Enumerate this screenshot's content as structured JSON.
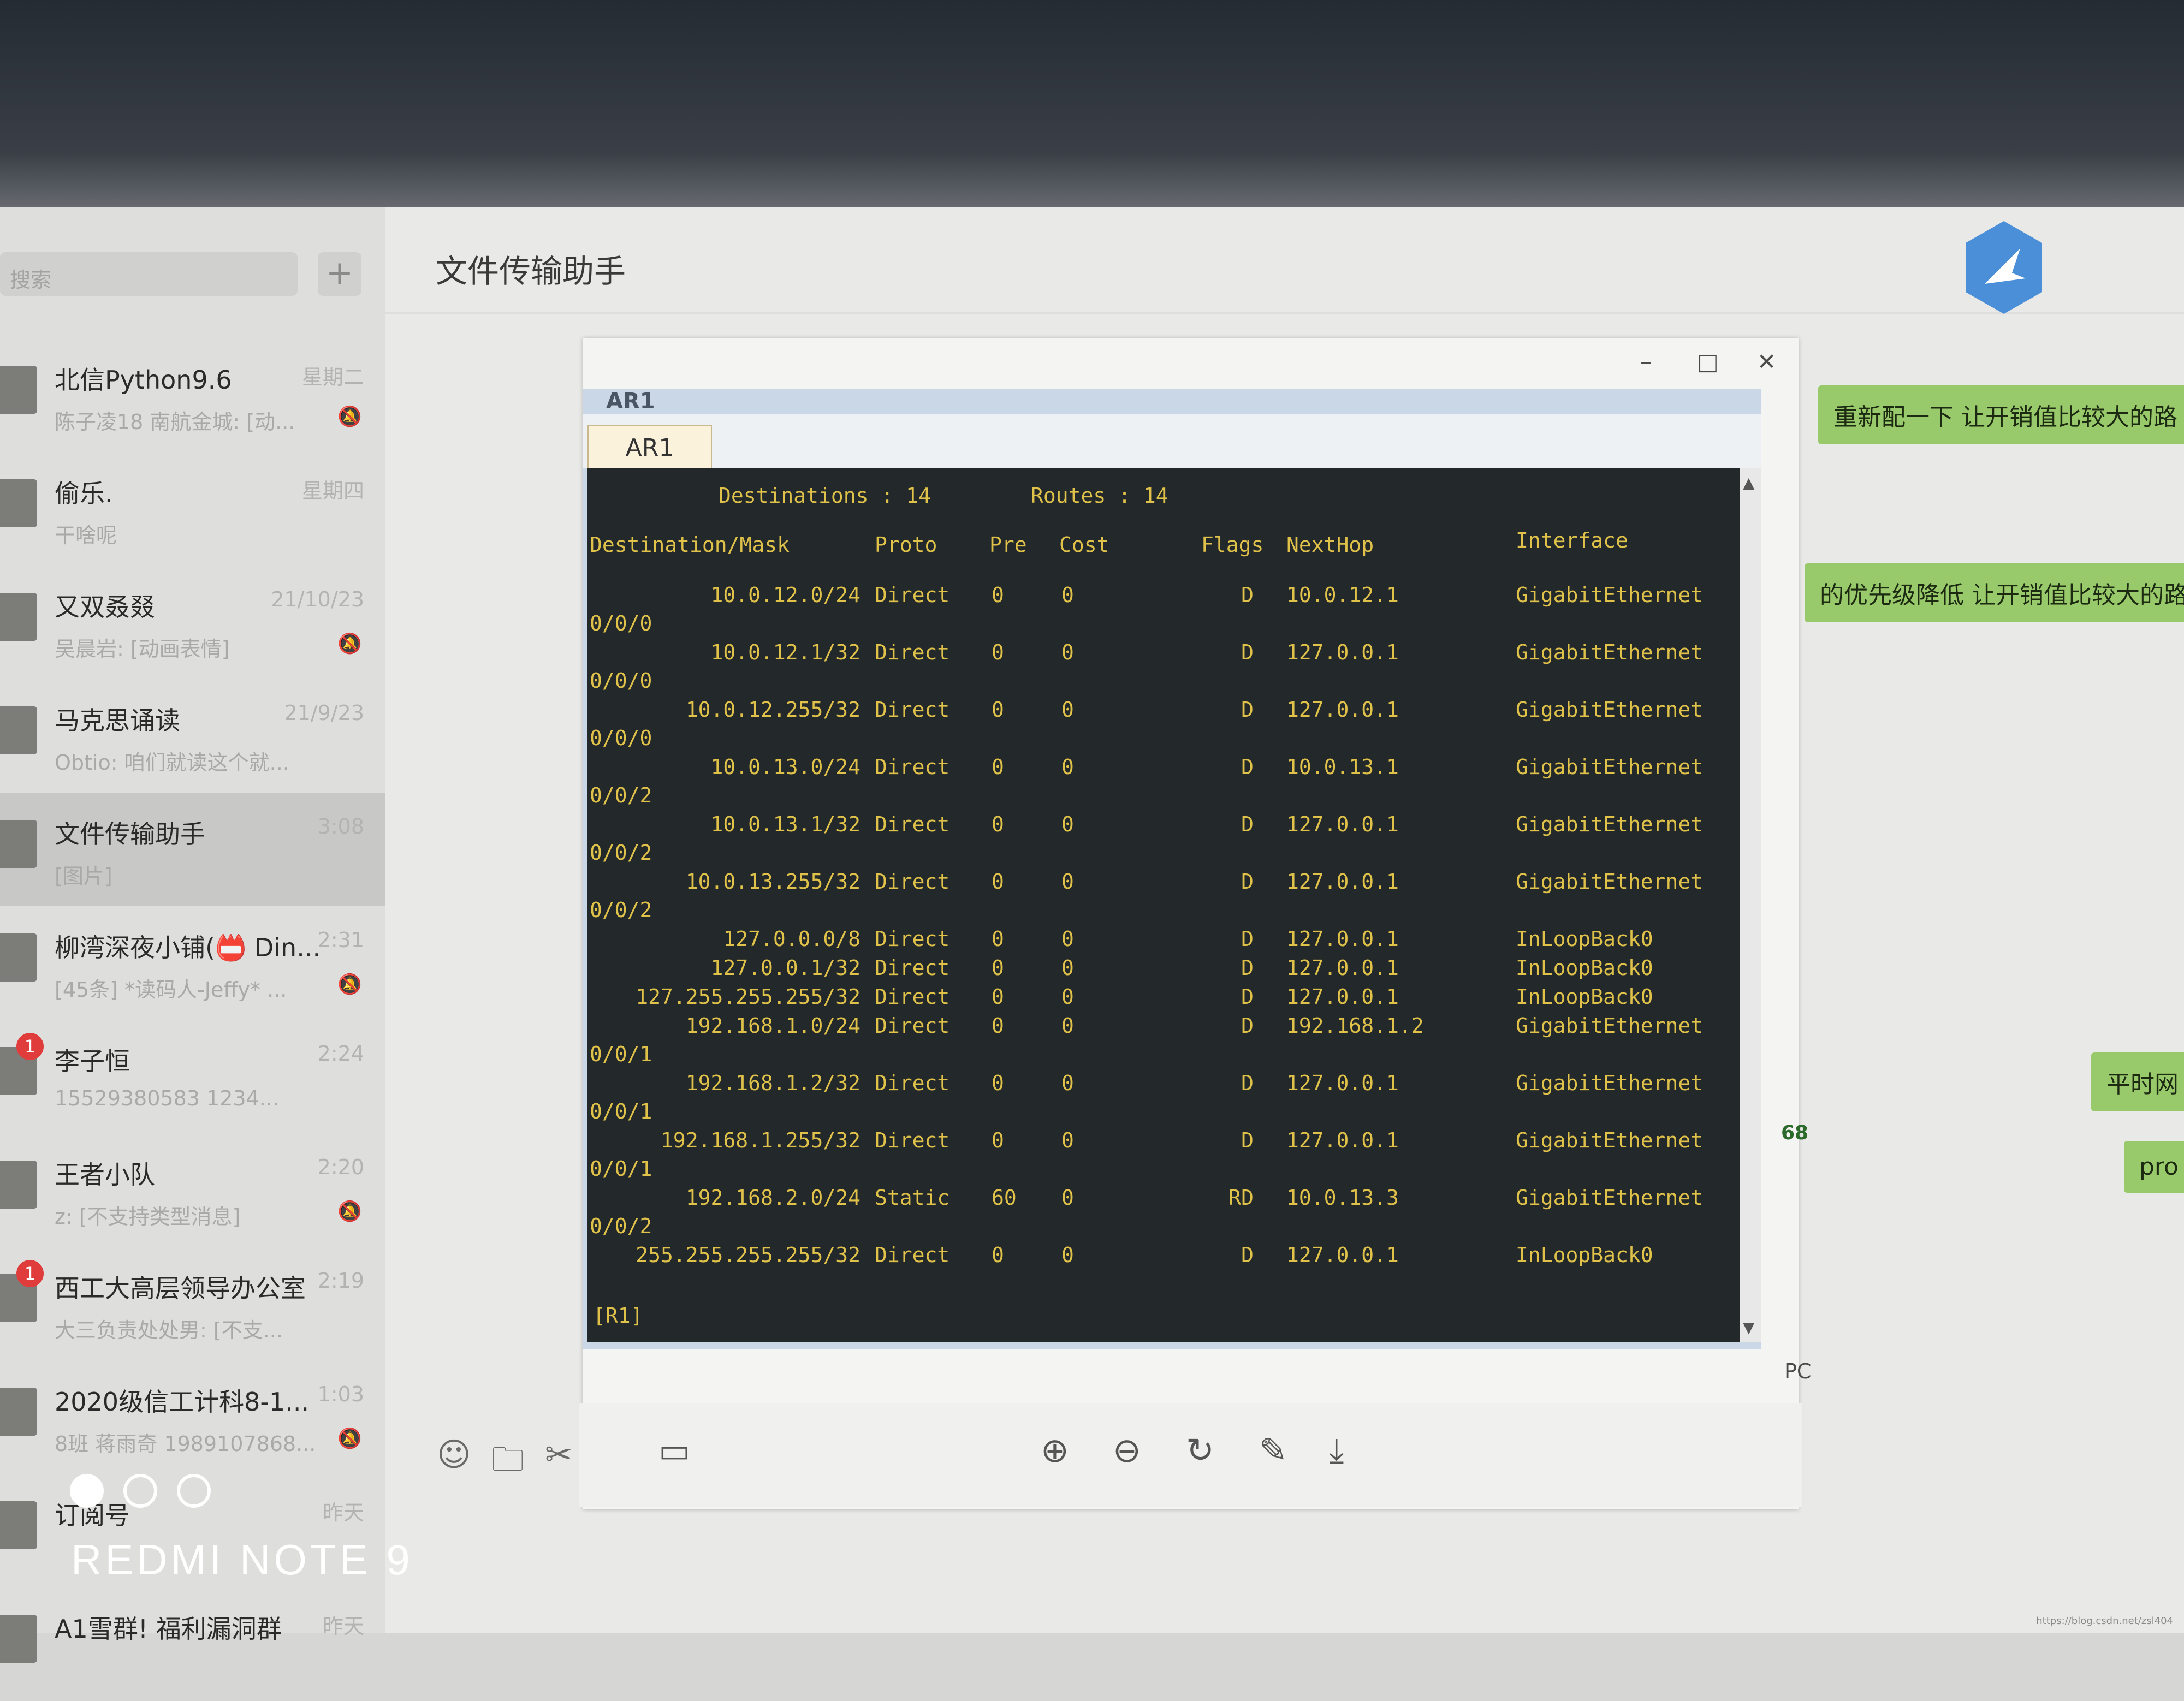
{
  "sidebar": {
    "search_placeholder": "搜索",
    "add_label": "+",
    "chats": [
      {
        "name": "北信Python9.6",
        "time": "星期二",
        "preview": "陈子凌18 南航金城: [动...",
        "muted": "🔕"
      },
      {
        "name": "偷乐.",
        "time": "星期四",
        "preview": "干啥呢",
        "muted": ""
      },
      {
        "name": "又双叒叕",
        "time": "21/10/23",
        "preview": "吴晨岩: [动画表情]",
        "muted": "🔕"
      },
      {
        "name": "马克思诵读",
        "time": "21/9/23",
        "preview": "Obtio: 咱们就读这个就...",
        "muted": ""
      },
      {
        "name": "文件传输助手",
        "time": "3:08",
        "preview": "[图片]",
        "muted": ""
      },
      {
        "name": "柳湾深夜小铺(📛 Din...",
        "time": "2:31",
        "preview": "[45条] *读码人-Jeffy* ...",
        "muted": "🔕"
      },
      {
        "name": "李子恒",
        "time": "2:24",
        "preview": "15529380583      1234...",
        "muted": "",
        "badge": "1"
      },
      {
        "name": "王者小队",
        "time": "2:20",
        "preview": "z: [不支持类型消息]",
        "muted": "🔕"
      },
      {
        "name": "西工大高层领导办公室",
        "time": "2:19",
        "preview": "大三负责处处男: [不支...",
        "muted": "",
        "badge": "1"
      },
      {
        "name": "2020级信工计科8-1...",
        "time": "1:03",
        "preview": "8班 蒋雨奇 1989107868...",
        "muted": "🔕"
      },
      {
        "name": "订阅号",
        "time": "昨天",
        "preview": "",
        "muted": ""
      },
      {
        "name": "A1雪群! 福利漏洞群",
        "time": "昨天",
        "preview": "",
        "muted": ""
      }
    ]
  },
  "chat": {
    "title": "文件传输助手",
    "bubbles": [
      "重新配一下 让开销值比较大的路",
      "的优先级降低 让开销值比较大的路",
      "平时网",
      "pro"
    ]
  },
  "viewer": {
    "minimize": "–",
    "maximize": "□",
    "close": "✕"
  },
  "ar1": {
    "window_title": "AR1",
    "tab_label": "AR1",
    "summary": "Destinations : 14        Routes : 14",
    "headers": [
      "Destination/Mask",
      "Proto",
      "Pre",
      "Cost",
      "Flags",
      "NextHop",
      "Interface"
    ],
    "routes": [
      {
        "dest": "10.0.12.0/24",
        "proto": "Direct",
        "pre": "0",
        "cost": "0",
        "flags": "D",
        "nexthop": "10.0.12.1",
        "iface": "GigabitEthernet",
        "iface2": "0/0/0"
      },
      {
        "dest": "10.0.12.1/32",
        "proto": "Direct",
        "pre": "0",
        "cost": "0",
        "flags": "D",
        "nexthop": "127.0.0.1",
        "iface": "GigabitEthernet",
        "iface2": "0/0/0"
      },
      {
        "dest": "10.0.12.255/32",
        "proto": "Direct",
        "pre": "0",
        "cost": "0",
        "flags": "D",
        "nexthop": "127.0.0.1",
        "iface": "GigabitEthernet",
        "iface2": "0/0/0"
      },
      {
        "dest": "10.0.13.0/24",
        "proto": "Direct",
        "pre": "0",
        "cost": "0",
        "flags": "D",
        "nexthop": "10.0.13.1",
        "iface": "GigabitEthernet",
        "iface2": "0/0/2"
      },
      {
        "dest": "10.0.13.1/32",
        "proto": "Direct",
        "pre": "0",
        "cost": "0",
        "flags": "D",
        "nexthop": "127.0.0.1",
        "iface": "GigabitEthernet",
        "iface2": "0/0/2"
      },
      {
        "dest": "10.0.13.255/32",
        "proto": "Direct",
        "pre": "0",
        "cost": "0",
        "flags": "D",
        "nexthop": "127.0.0.1",
        "iface": "GigabitEthernet",
        "iface2": "0/0/2"
      },
      {
        "dest": "127.0.0.0/8",
        "proto": "Direct",
        "pre": "0",
        "cost": "0",
        "flags": "D",
        "nexthop": "127.0.0.1",
        "iface": "InLoopBack0",
        "iface2": ""
      },
      {
        "dest": "127.0.0.1/32",
        "proto": "Direct",
        "pre": "0",
        "cost": "0",
        "flags": "D",
        "nexthop": "127.0.0.1",
        "iface": "InLoopBack0",
        "iface2": ""
      },
      {
        "dest": "127.255.255.255/32",
        "proto": "Direct",
        "pre": "0",
        "cost": "0",
        "flags": "D",
        "nexthop": "127.0.0.1",
        "iface": "InLoopBack0",
        "iface2": ""
      },
      {
        "dest": "192.168.1.0/24",
        "proto": "Direct",
        "pre": "0",
        "cost": "0",
        "flags": "D",
        "nexthop": "192.168.1.2",
        "iface": "GigabitEthernet",
        "iface2": "0/0/1"
      },
      {
        "dest": "192.168.1.2/32",
        "proto": "Direct",
        "pre": "0",
        "cost": "0",
        "flags": "D",
        "nexthop": "127.0.0.1",
        "iface": "GigabitEthernet",
        "iface2": "0/0/1"
      },
      {
        "dest": "192.168.1.255/32",
        "proto": "Direct",
        "pre": "0",
        "cost": "0",
        "flags": "D",
        "nexthop": "127.0.0.1",
        "iface": "GigabitEthernet",
        "iface2": "0/0/1"
      },
      {
        "dest": "192.168.2.0/24",
        "proto": "Static",
        "pre": "60",
        "cost": "0",
        "flags": "RD",
        "nexthop": "10.0.13.3",
        "iface": "GigabitEthernet",
        "iface2": "0/0/2"
      },
      {
        "dest": "255.255.255.255/32",
        "proto": "Direct",
        "pre": "0",
        "cost": "0",
        "flags": "D",
        "nexthop": "127.0.0.1",
        "iface": "InLoopBack0",
        "iface2": ""
      }
    ],
    "prompt": "[R1]"
  },
  "side": {
    "pc_label": "PC",
    "num_label": "68"
  },
  "camera": {
    "text": "REDMI NOTE 9"
  },
  "watermark": "https://blog.csdn.net/zsl404"
}
